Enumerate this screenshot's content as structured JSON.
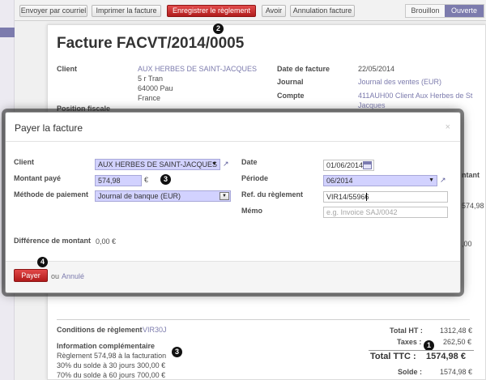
{
  "toolbar": {
    "send_email": "Envoyer par courriel",
    "print": "Imprimer la facture",
    "register_payment": "Enregistrer le règlement",
    "refund": "Avoir",
    "cancel_invoice": "Annulation facture"
  },
  "status": {
    "draft": "Brouillon",
    "open": "Ouverte"
  },
  "invoice": {
    "title": "Facture FACVT/2014/0005",
    "client_label": "Client",
    "client_name": "AUX HERBES DE SAINT-JACQUES",
    "address1": "5 r Tran",
    "address2": "64000 Pau",
    "country": "France",
    "fiscal_label": "Position fiscale",
    "date_label": "Date de facture",
    "date_value": "22/05/2014",
    "journal_label": "Journal",
    "journal_value": "Journal des ventes (EUR)",
    "account_label": "Compte",
    "account_value_line1": "411AUH00 Client Aux Herbes de St",
    "account_value_line2": "Jacques",
    "right_col_fragment": "ntant",
    "right_val1": "574,98",
    "right_val2": ",00",
    "conditions_label": "Conditions de règlement",
    "conditions_value": "VIR30J",
    "info_label": "Information complémentaire",
    "info_line1": "Règlement 574,98 à la facturation",
    "info_line2": "30% du solde à 30 jours 300,00 €",
    "info_line3": "70% du solde à 60 jours  700,00 €",
    "total_ht_label": "Total HT :",
    "total_ht_value": "1312,48 €",
    "taxes_label": "Taxes :",
    "taxes_value": "262,50 €",
    "total_ttc_label": "Total TTC :",
    "total_ttc_value": "1574,98 €",
    "balance_label": "Solde :",
    "balance_value": "1574,98 €"
  },
  "dialog": {
    "title": "Payer la facture",
    "close": "×",
    "client_label": "Client",
    "client_value": "AUX HERBES DE SAINT-JACQUES",
    "amount_label": "Montant payé",
    "amount_value": "574,98",
    "currency": "€",
    "method_label": "Méthode de paiement",
    "method_value": "Journal de banque (EUR)",
    "date_label": "Date",
    "date_value": "01/06/2014",
    "period_label": "Période",
    "period_value": "06/2014",
    "ref_label": "Ref. du règlement",
    "ref_value": "VIR14/55966",
    "memo_label": "Mémo",
    "memo_placeholder": "e.g. Invoice SAJ/0042",
    "diff_label": "Différence de montant",
    "diff_value": "0,00 €",
    "pay_button": "Payer",
    "or_text": "ou",
    "cancel_link": "Annulé"
  },
  "markers": {
    "m2": "2",
    "m3a": "3",
    "m4": "4",
    "m1": "1",
    "m3b": "3"
  },
  "colors": {
    "accent": "#7c7bad",
    "primary_button": "#c62828",
    "required_field": "#d2d2ff"
  }
}
